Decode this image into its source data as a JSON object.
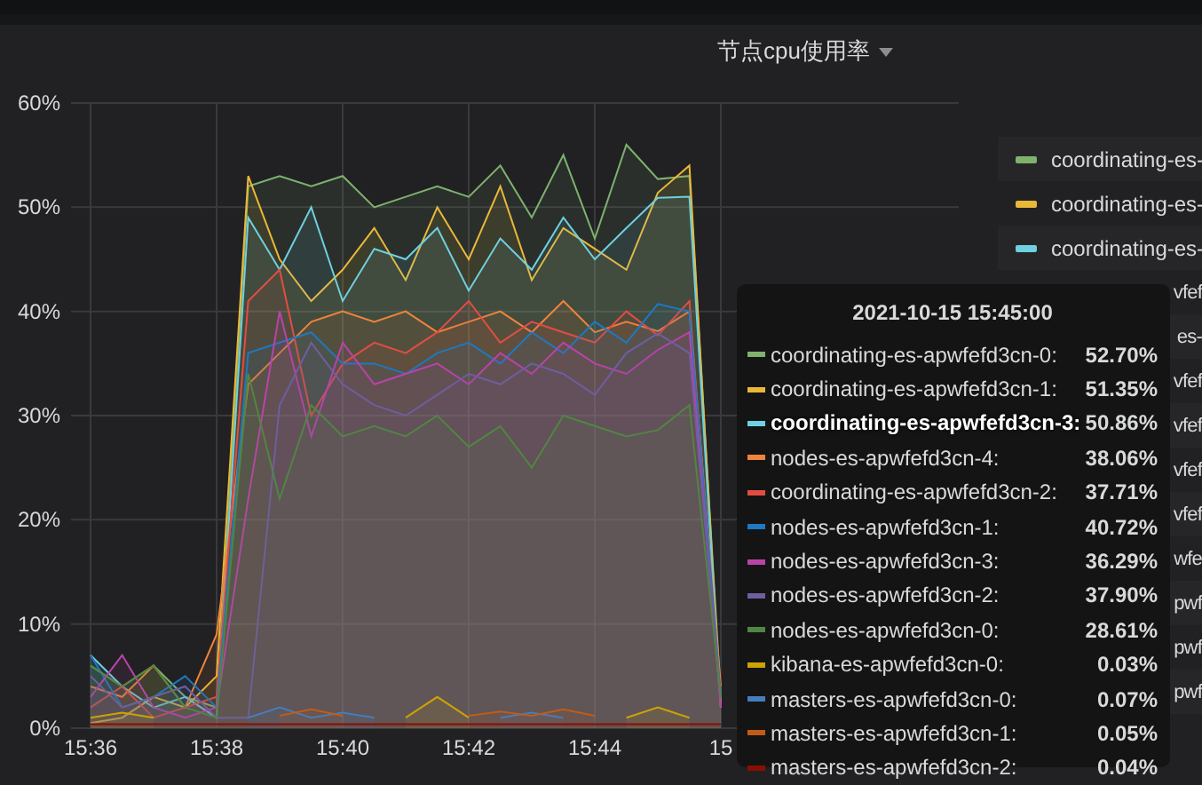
{
  "panel": {
    "title": "节点cpu使用率",
    "chart_data": {
      "type": "area",
      "grid": true,
      "categories": [
        "15:36",
        null,
        null,
        null,
        "15:38",
        null,
        null,
        null,
        "15:40",
        null,
        null,
        null,
        "15:42",
        null,
        null,
        null,
        "15:44",
        null,
        null,
        null,
        "15"
      ],
      "ylim": [
        0,
        60
      ],
      "yticks": [
        {
          "value": 0,
          "label": "0%"
        },
        {
          "value": 10,
          "label": "10%"
        },
        {
          "value": 20,
          "label": "20%"
        },
        {
          "value": 30,
          "label": "30%"
        },
        {
          "value": 40,
          "label": "40%"
        },
        {
          "value": 50,
          "label": "50%"
        },
        {
          "value": 60,
          "label": "60%"
        }
      ],
      "series": [
        {
          "color": "#7eb26d",
          "values": [
            6,
            4,
            6,
            3,
            2,
            52,
            53,
            52,
            53,
            50,
            51,
            52,
            51,
            54,
            49,
            55,
            47,
            56,
            52.7,
            53,
            3
          ]
        },
        {
          "color": "#eab839",
          "values": [
            0.5,
            1,
            3,
            2,
            5,
            53,
            45,
            41,
            44,
            48,
            43,
            50,
            45,
            52,
            43,
            48,
            46,
            44,
            51.4,
            54,
            2
          ]
        },
        {
          "color": "#6ed0e0",
          "values": [
            7,
            4,
            2,
            3,
            1,
            49,
            44,
            50,
            41,
            46,
            45,
            48,
            42,
            47,
            44,
            49,
            45,
            48,
            50.9,
            51,
            2
          ]
        },
        {
          "color": "#ef843c",
          "values": [
            4,
            3,
            6,
            2,
            9,
            33,
            36,
            39,
            40,
            39,
            40,
            38,
            39,
            40,
            38,
            41,
            38,
            39,
            38.1,
            40,
            4
          ]
        },
        {
          "color": "#e24d42",
          "values": [
            2,
            4,
            1,
            2,
            3,
            41,
            44,
            30,
            35,
            37,
            36,
            38,
            41,
            37,
            39,
            38,
            37,
            40,
            37.7,
            41,
            2
          ]
        },
        {
          "color": "#1f78c1",
          "values": [
            7,
            2,
            3,
            5,
            2,
            36,
            37,
            38,
            35,
            35,
            34,
            36,
            37,
            35,
            38,
            36,
            39,
            37,
            40.7,
            40,
            3
          ]
        },
        {
          "color": "#ba43a9",
          "values": [
            3,
            7,
            2,
            1,
            2,
            22,
            40,
            28,
            37,
            33,
            34,
            35,
            33,
            36,
            34,
            37,
            35,
            34,
            36.3,
            38,
            2
          ]
        },
        {
          "color": "#705da0",
          "values": [
            5,
            2,
            3,
            4,
            1,
            1,
            31,
            37,
            33,
            31,
            30,
            32,
            34,
            33,
            35,
            34,
            32,
            36,
            37.9,
            36,
            3
          ]
        },
        {
          "color": "#508642",
          "values": [
            6,
            4,
            6,
            2,
            1,
            34,
            22,
            31,
            28,
            29,
            28,
            30,
            27,
            29,
            25,
            30,
            29,
            28,
            28.6,
            31,
            3
          ]
        },
        {
          "color": "#cca300",
          "values": [
            1,
            1.5,
            1,
            null,
            null,
            null,
            null,
            null,
            null,
            null,
            1,
            3,
            1,
            null,
            null,
            null,
            null,
            1,
            2,
            1,
            null
          ]
        },
        {
          "color": "#447ebc",
          "values": [
            null,
            null,
            null,
            null,
            null,
            1,
            2,
            1,
            1.5,
            1,
            null,
            null,
            null,
            1,
            1.5,
            1,
            null,
            null,
            null,
            null,
            null
          ]
        },
        {
          "color": "#c15c17",
          "values": [
            null,
            null,
            null,
            null,
            null,
            null,
            1.2,
            1.8,
            1.2,
            null,
            null,
            null,
            1.2,
            1.6,
            1.2,
            1.8,
            1.2,
            null,
            null,
            null,
            null
          ]
        },
        {
          "color": "#890f02",
          "values": [
            0.4,
            0.4,
            0.4,
            0.4,
            0.4,
            0.4,
            0.4,
            0.4,
            0.4,
            0.4,
            0.4,
            0.4,
            0.4,
            0.4,
            0.4,
            0.4,
            0.4,
            0.4,
            0.4,
            0.4,
            0.4
          ]
        }
      ]
    }
  },
  "legend": {
    "items": [
      {
        "label": "coordinating-es-",
        "color": "#7eb26d"
      },
      {
        "label": "coordinating-es-",
        "color": "#eab839"
      },
      {
        "label": "coordinating-es-",
        "color": "#6ed0e0"
      },
      {
        "label": "vfef"
      },
      {
        "label": "es-"
      },
      {
        "label": "vfef"
      },
      {
        "label": "vfef"
      },
      {
        "label": "vfef"
      },
      {
        "label": "vfef"
      },
      {
        "label": "wfe"
      },
      {
        "label": "pwf"
      },
      {
        "label": "pwf"
      },
      {
        "label": "pwf"
      }
    ]
  },
  "tooltip": {
    "title": "2021-10-15 15:45:00",
    "rows": [
      {
        "name": "coordinating-es-apwfefd3cn-0:",
        "value": "52.70%",
        "color": "#7eb26d",
        "highlighted": false
      },
      {
        "name": "coordinating-es-apwfefd3cn-1:",
        "value": "51.35%",
        "color": "#eab839",
        "highlighted": false
      },
      {
        "name": "coordinating-es-apwfefd3cn-3:",
        "value": "50.86%",
        "color": "#6ed0e0",
        "highlighted": true
      },
      {
        "name": "nodes-es-apwfefd3cn-4:",
        "value": "38.06%",
        "color": "#ef843c",
        "highlighted": false
      },
      {
        "name": "coordinating-es-apwfefd3cn-2:",
        "value": "37.71%",
        "color": "#e24d42",
        "highlighted": false
      },
      {
        "name": "nodes-es-apwfefd3cn-1:",
        "value": "40.72%",
        "color": "#1f78c1",
        "highlighted": false
      },
      {
        "name": "nodes-es-apwfefd3cn-3:",
        "value": "36.29%",
        "color": "#ba43a9",
        "highlighted": false
      },
      {
        "name": "nodes-es-apwfefd3cn-2:",
        "value": "37.90%",
        "color": "#705da0",
        "highlighted": false
      },
      {
        "name": "nodes-es-apwfefd3cn-0:",
        "value": "28.61%",
        "color": "#508642",
        "highlighted": false
      },
      {
        "name": "kibana-es-apwfefd3cn-0:",
        "value": "0.03%",
        "color": "#cca300",
        "highlighted": false
      },
      {
        "name": "masters-es-apwfefd3cn-0:",
        "value": "0.07%",
        "color": "#447ebc",
        "highlighted": false
      },
      {
        "name": "masters-es-apwfefd3cn-1:",
        "value": "0.05%",
        "color": "#c15c17",
        "highlighted": false
      },
      {
        "name": "masters-es-apwfefd3cn-2:",
        "value": "0.04%",
        "color": "#890f02",
        "highlighted": false
      }
    ]
  }
}
